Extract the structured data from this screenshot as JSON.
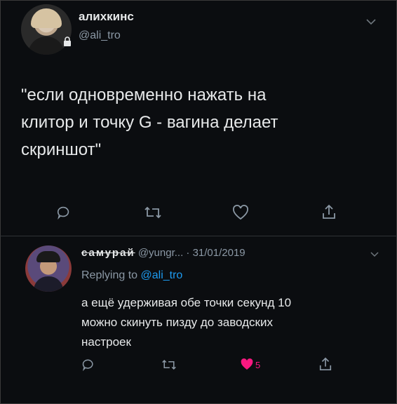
{
  "tweet": {
    "author_name": "алихкинс",
    "author_handle": "@ali_tro",
    "text": "\"если одновременно нажать на\nклитор и точку G - вагина делает\nскриншот\""
  },
  "reply": {
    "author_name": "самурай",
    "handle_date": "@yungr... · 31/01/2019",
    "replying_label": "Replying to",
    "replying_handle": "@ali_tro",
    "text": "а ещё удерживая обе точки секунд 10\nможно скинуть пизду до заводских\nнастроек",
    "like_count": "5"
  },
  "icons": {
    "reply": "reply-icon",
    "retweet": "retweet-icon",
    "like": "heart-icon",
    "share": "share-icon",
    "menu": "chevron-down-icon",
    "protected": "lock-icon"
  },
  "colors": {
    "background": "#0b0d10",
    "accent": "#1d9bf0",
    "like": "#f91880",
    "muted": "#8b98a5"
  }
}
